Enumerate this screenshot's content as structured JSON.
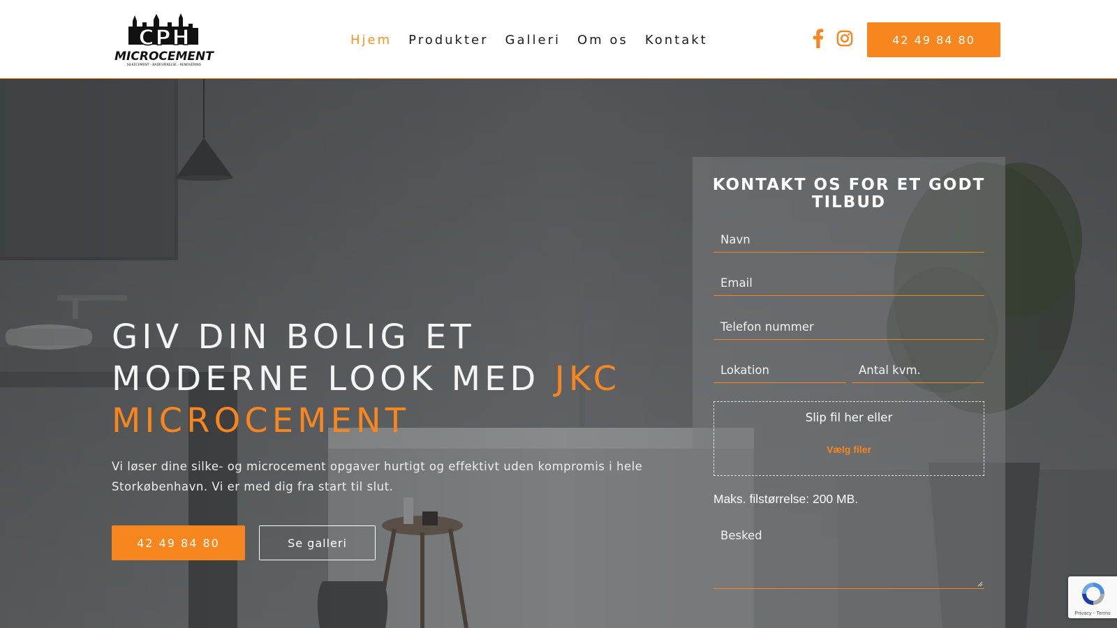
{
  "logo": {
    "top_text": "CPH",
    "main_text": "MICROCEMENT",
    "tagline": "SILKECEMENT - BADEVÆRELSE - RENOVERING"
  },
  "nav": {
    "items": [
      {
        "label": "Hjem",
        "active": true
      },
      {
        "label": "Produkter",
        "active": false
      },
      {
        "label": "Galleri",
        "active": false
      },
      {
        "label": "Om os",
        "active": false
      },
      {
        "label": "Kontakt",
        "active": false
      }
    ]
  },
  "header": {
    "social_icons": [
      "facebook-icon",
      "instagram-icon"
    ],
    "phone_button": "42 49 84 80"
  },
  "hero": {
    "title_white": "GIV DIN BOLIG ET MODERNE LOOK MED",
    "title_accent": "JKC MICROCEMENT",
    "subtitle": "Vi løser dine silke- og microcement opgaver hurtigt og effektivt uden kompromis i hele Storkøbenhavn. Vi er med dig fra start til slut.",
    "phone_button": "42 49 84 80",
    "gallery_button": "Se galleri"
  },
  "form": {
    "title": "KONTAKT OS FOR ET GODT TILBUD",
    "name_placeholder": "Navn",
    "email_placeholder": "Email",
    "phone_placeholder": "Telefon nummer",
    "location_placeholder": "Lokation",
    "sqm_placeholder": "Antal kvm.",
    "dropzone_text": "Slip fil her eller",
    "dropzone_button": "Vælg filer",
    "max_size": "Maks. filstørrelse: 200 MB.",
    "message_placeholder": "Besked"
  },
  "recaptcha": {
    "links": "Privacy - Terms"
  },
  "colors": {
    "accent": "#f7861e",
    "header_bg": "#ffffff",
    "text_dark": "#1c1c1c"
  }
}
